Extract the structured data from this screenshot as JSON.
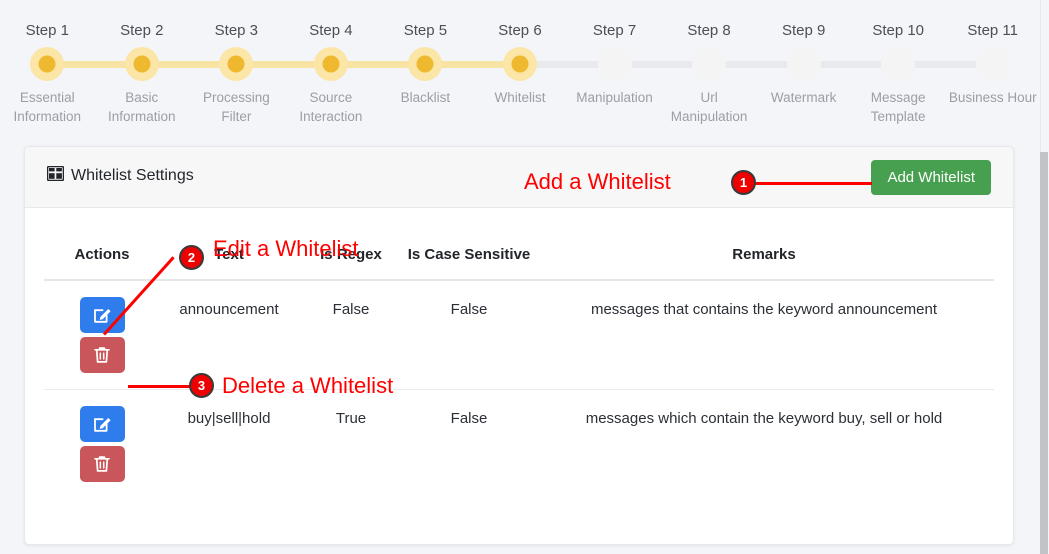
{
  "stepper": {
    "active_through": 6,
    "active_color": "#eeb92e",
    "halo_color": "#fbe6a8",
    "bar_active_color": "#f7e3a4",
    "bar_inactive_color": "#e8eaed",
    "steps": [
      {
        "title": "Step 1",
        "label": "Essential Information"
      },
      {
        "title": "Step 2",
        "label": "Basic Information"
      },
      {
        "title": "Step 3",
        "label": "Processing Filter"
      },
      {
        "title": "Step 4",
        "label": "Source Interaction"
      },
      {
        "title": "Step 5",
        "label": "Blacklist"
      },
      {
        "title": "Step 6",
        "label": "Whitelist"
      },
      {
        "title": "Step 7",
        "label": "Manipulation"
      },
      {
        "title": "Step 8",
        "label": "Url Manipulation"
      },
      {
        "title": "Step 9",
        "label": "Watermark"
      },
      {
        "title": "Step 10",
        "label": "Message Template"
      },
      {
        "title": "Step 11",
        "label": "Business Hour"
      }
    ]
  },
  "card": {
    "title": "Whitelist Settings",
    "title_icon": "table-grid-icon",
    "add_button": {
      "label": "Add Whitelist",
      "color": "#47a04f"
    }
  },
  "table": {
    "columns": [
      {
        "key": "actions",
        "label": "Actions"
      },
      {
        "key": "text",
        "label": "Text"
      },
      {
        "key": "regex",
        "label": "Is Regex"
      },
      {
        "key": "case",
        "label": "Is Case Sensitive"
      },
      {
        "key": "remarks",
        "label": "Remarks"
      }
    ],
    "rows": [
      {
        "text": "announcement",
        "regex": "False",
        "case": "False",
        "remarks": "messages that contains the keyword announcement",
        "edit_icon": "pencil-square-icon",
        "delete_icon": "trash-icon"
      },
      {
        "text": "buy|sell|hold",
        "regex": "True",
        "case": "False",
        "remarks": "messages which contain the keyword buy, sell or hold",
        "edit_icon": "pencil-square-icon",
        "delete_icon": "trash-icon"
      }
    ]
  },
  "annotations": {
    "color": "#ff0000",
    "items": [
      {
        "number": "1",
        "label": "Add a Whitelist"
      },
      {
        "number": "2",
        "label": "Edit a Whitelist"
      },
      {
        "number": "3",
        "label": "Delete a Whitelist"
      }
    ]
  }
}
